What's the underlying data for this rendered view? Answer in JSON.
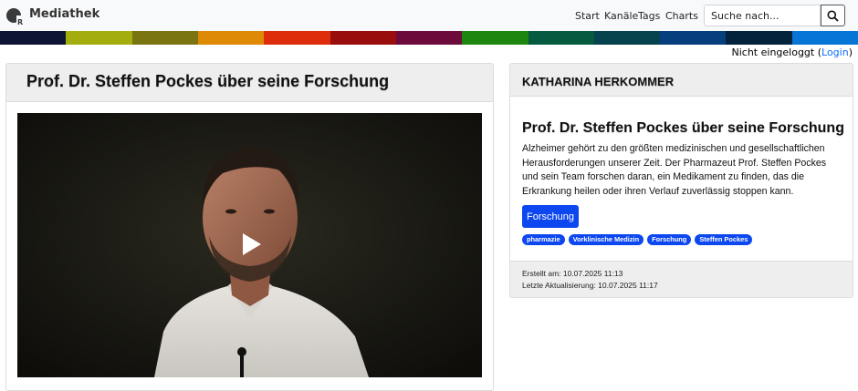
{
  "header": {
    "brand": "Mediathek",
    "nav": [
      "Start",
      "Kanäle",
      "Tags",
      "Charts"
    ],
    "search_placeholder": "Suche nach..."
  },
  "stripe_colors": [
    "#0e1433",
    "#a3ad0d",
    "#7a7411",
    "#df8a06",
    "#de2d0b",
    "#990d0d",
    "#6c0b3b",
    "#1c860f",
    "#055a3f",
    "#07434f",
    "#073e7d",
    "#03223b",
    "#0675d6"
  ],
  "login": {
    "text": "Nicht eingeloggt (",
    "link": "Login",
    "suffix": ")"
  },
  "video": {
    "title": "Prof. Dr. Steffen Pockes über seine Forschung"
  },
  "info": {
    "person": "KATHARINA HERKOMMER",
    "title": "Prof. Dr. Steffen Pockes über seine Forschung",
    "description": "Alzheimer gehört zu den größten medizinischen und gesellschaftlichen Herausforderungen unserer Zeit. Der Pharmazeut Prof. Steffen Pockes und sein Team forschen daran, ein Medikament zu finden, das die Erkrankung heilen oder ihren Verlauf zuverlässig stoppen kann.",
    "category": "Forschung",
    "tags": [
      "pharmazie",
      "Vorklinische Medizin",
      "Forschung",
      "Steffen Pockes"
    ],
    "created": "Erstellt am: 10.07.2025 11:13",
    "updated": "Letzte Aktualisierung: 10.07.2025 11:17"
  }
}
